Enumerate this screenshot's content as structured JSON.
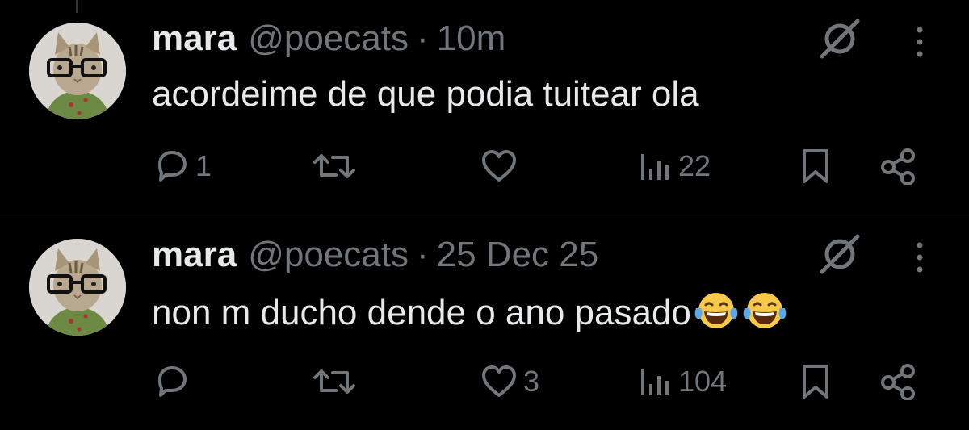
{
  "tweets": [
    {
      "author_name": "mara",
      "handle": "@poecats",
      "separator": "·",
      "time": "10m",
      "text": "acordeime de que podia tuitear ola",
      "emojis": [],
      "replies": "1",
      "retweets": "",
      "likes": "",
      "views": "22"
    },
    {
      "author_name": "mara",
      "handle": "@poecats",
      "separator": "·",
      "time": "25 Dec 25",
      "text": "non m ducho dende o ano pasado",
      "emojis": [
        "face-with-tears-of-joy",
        "face-with-tears-of-joy"
      ],
      "replies": "",
      "retweets": "",
      "likes": "3",
      "views": "104"
    }
  ],
  "colors": {
    "background": "#000000",
    "primary_text": "#e7e9ea",
    "secondary_text": "#71767b",
    "divider": "#2f3336"
  },
  "icons": {
    "reply": "reply-icon",
    "retweet": "retweet-icon",
    "like": "heart-icon",
    "views": "views-icon",
    "bookmark": "bookmark-icon",
    "share": "share-icon",
    "grok": "grok-icon",
    "more": "more-icon"
  }
}
